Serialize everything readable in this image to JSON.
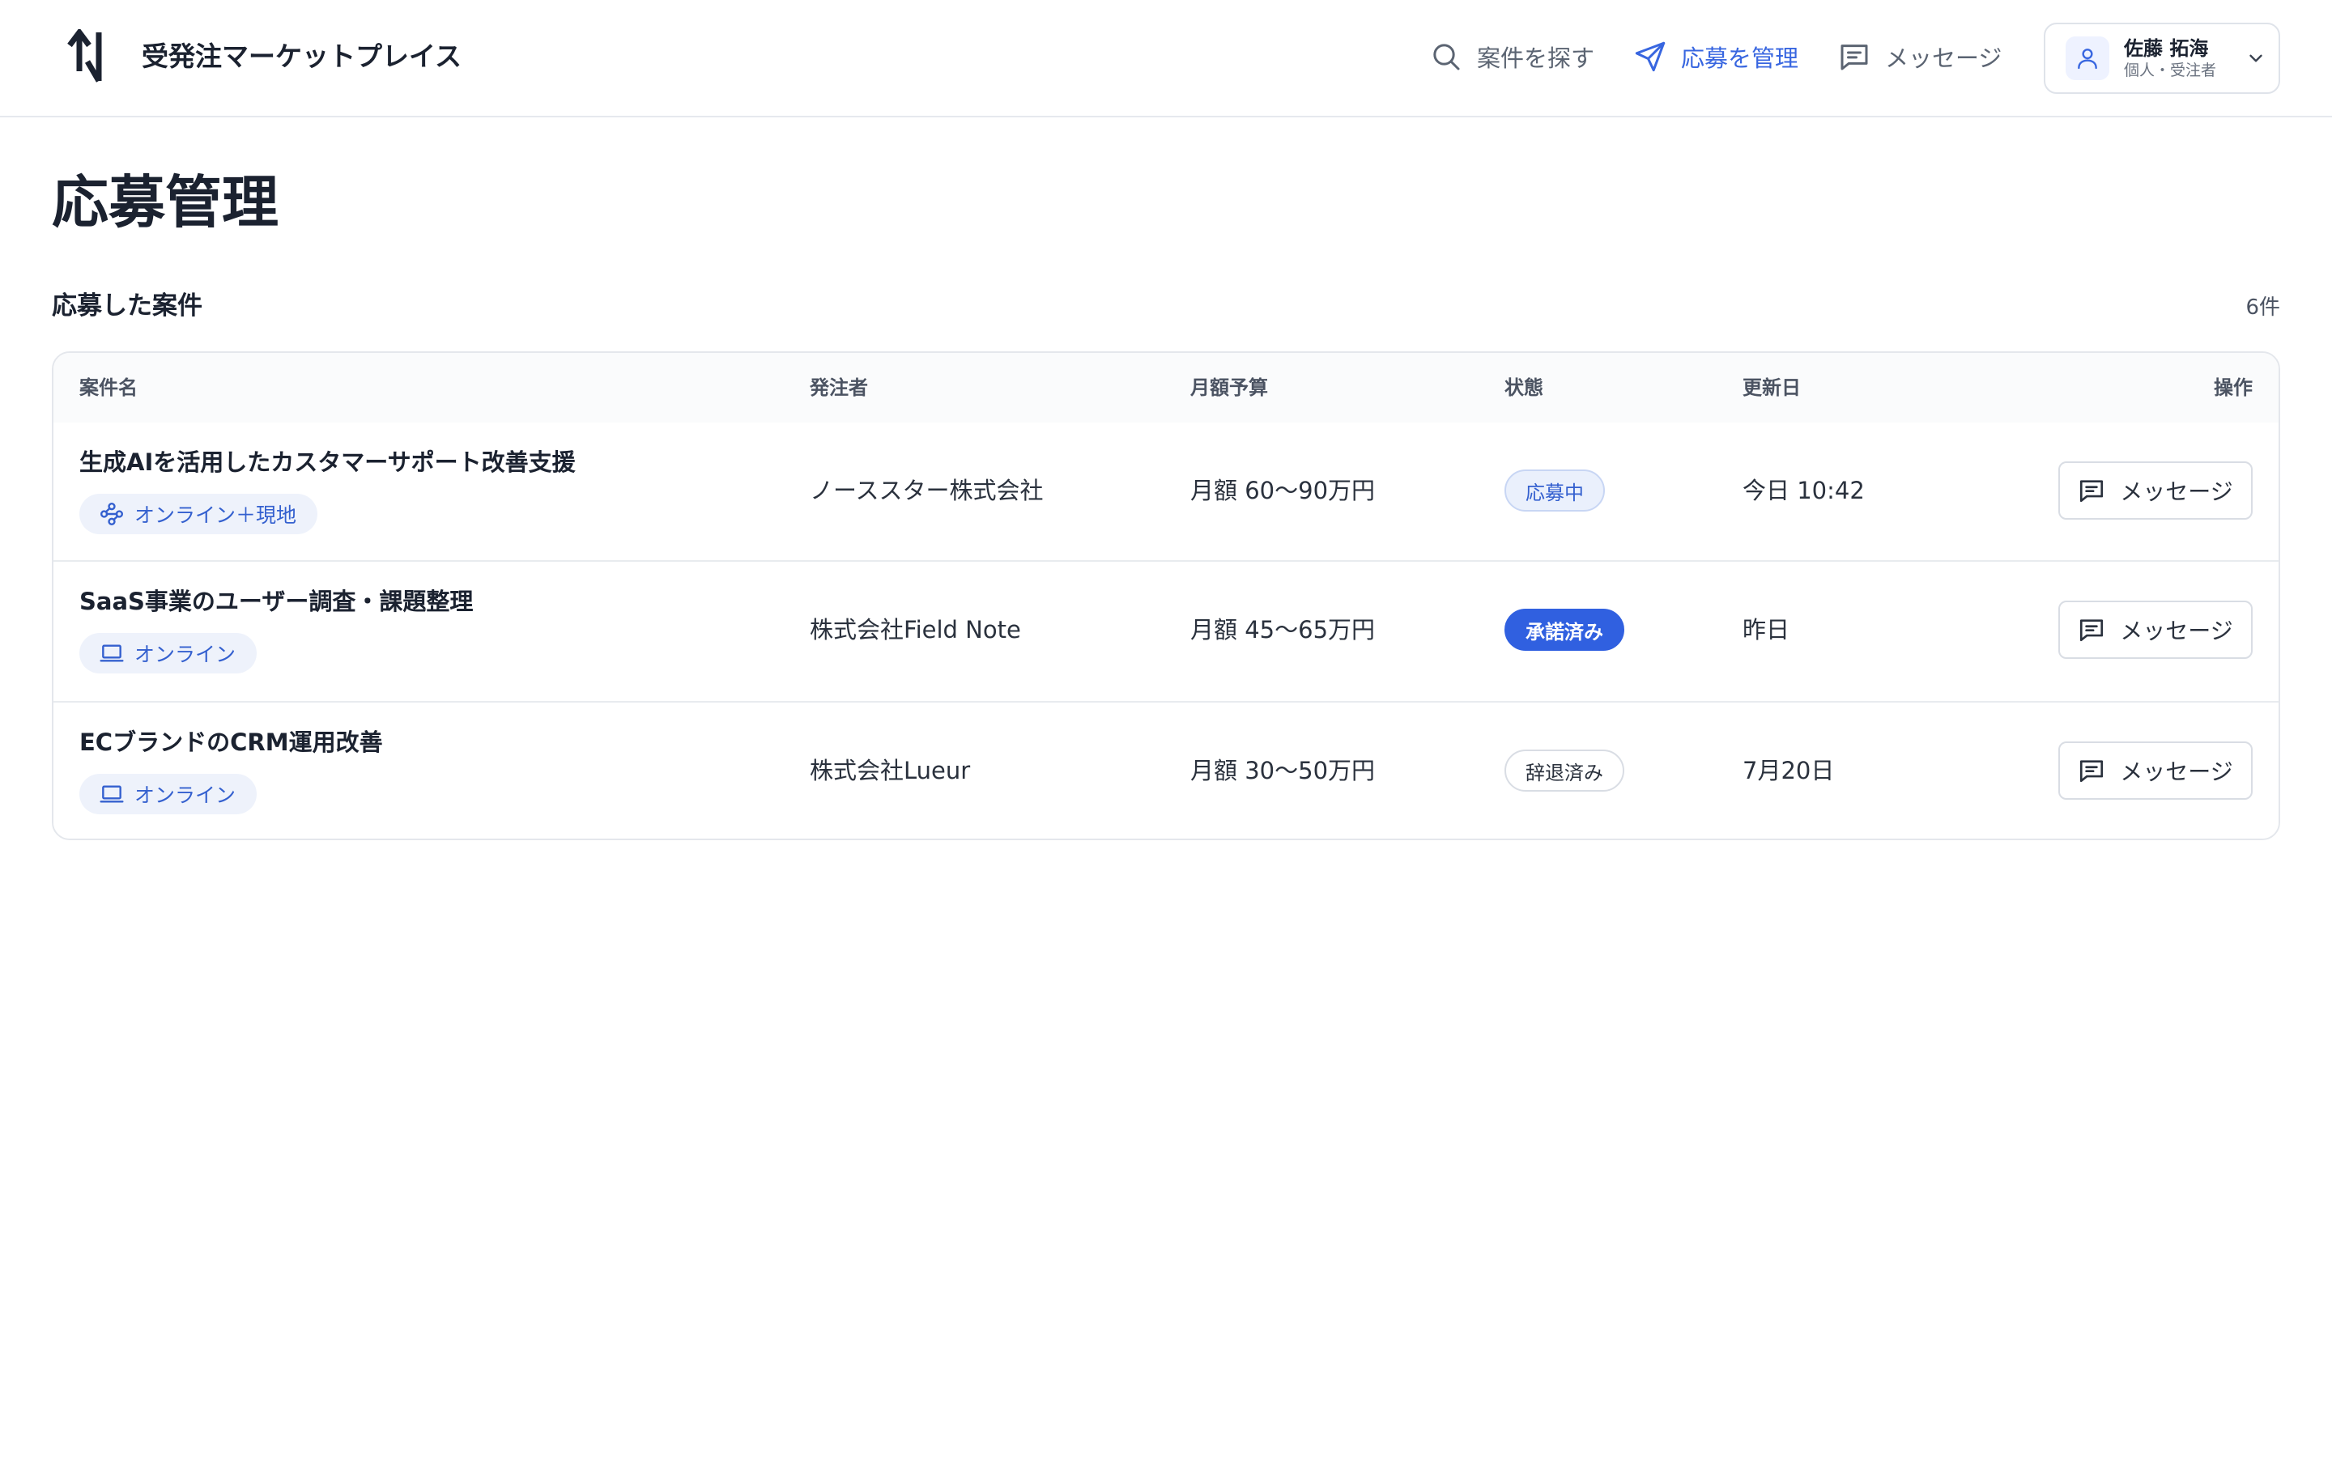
{
  "header": {
    "app_title": "受発注マーケットプレイス",
    "nav": {
      "search": "案件を探す",
      "manage": "応募を管理",
      "messages": "メッセージ"
    },
    "active_nav": "manage",
    "accent_color": "#3866e0",
    "user": {
      "name": "佐藤 拓海",
      "role": "個人・受注者"
    }
  },
  "page": {
    "title": "応募管理",
    "section_title": "応募した案件",
    "count": "6件"
  },
  "table": {
    "headers": {
      "name": "案件名",
      "client": "発注者",
      "budget": "月額予算",
      "status": "状態",
      "updated": "更新日",
      "action": "操作"
    },
    "rows": [
      {
        "title": "生成AIを活用したカスタマーサポート改善支援",
        "work_style": "オンライン＋現地",
        "work_style_icon": "network-icon",
        "client": "ノーススター株式会社",
        "budget": "月額 60〜90万円",
        "status": "応募中",
        "status_kind": "applied",
        "updated": "今日 10:42",
        "action_label": "メッセージ"
      },
      {
        "title": "SaaS事業のユーザー調査・課題整理",
        "work_style": "オンライン",
        "work_style_icon": "laptop-icon",
        "client": "株式会社Field Note",
        "budget": "月額 45〜65万円",
        "status": "承諾済み",
        "status_kind": "accepted",
        "updated": "昨日",
        "action_label": "メッセージ"
      },
      {
        "title": "ECブランドのCRM運用改善",
        "work_style": "オンライン",
        "work_style_icon": "laptop-icon",
        "client": "株式会社Lueur",
        "budget": "月額 30〜50万円",
        "status": "辞退済み",
        "status_kind": "withdrawn",
        "updated": "7月20日",
        "action_label": "メッセージ"
      }
    ]
  }
}
